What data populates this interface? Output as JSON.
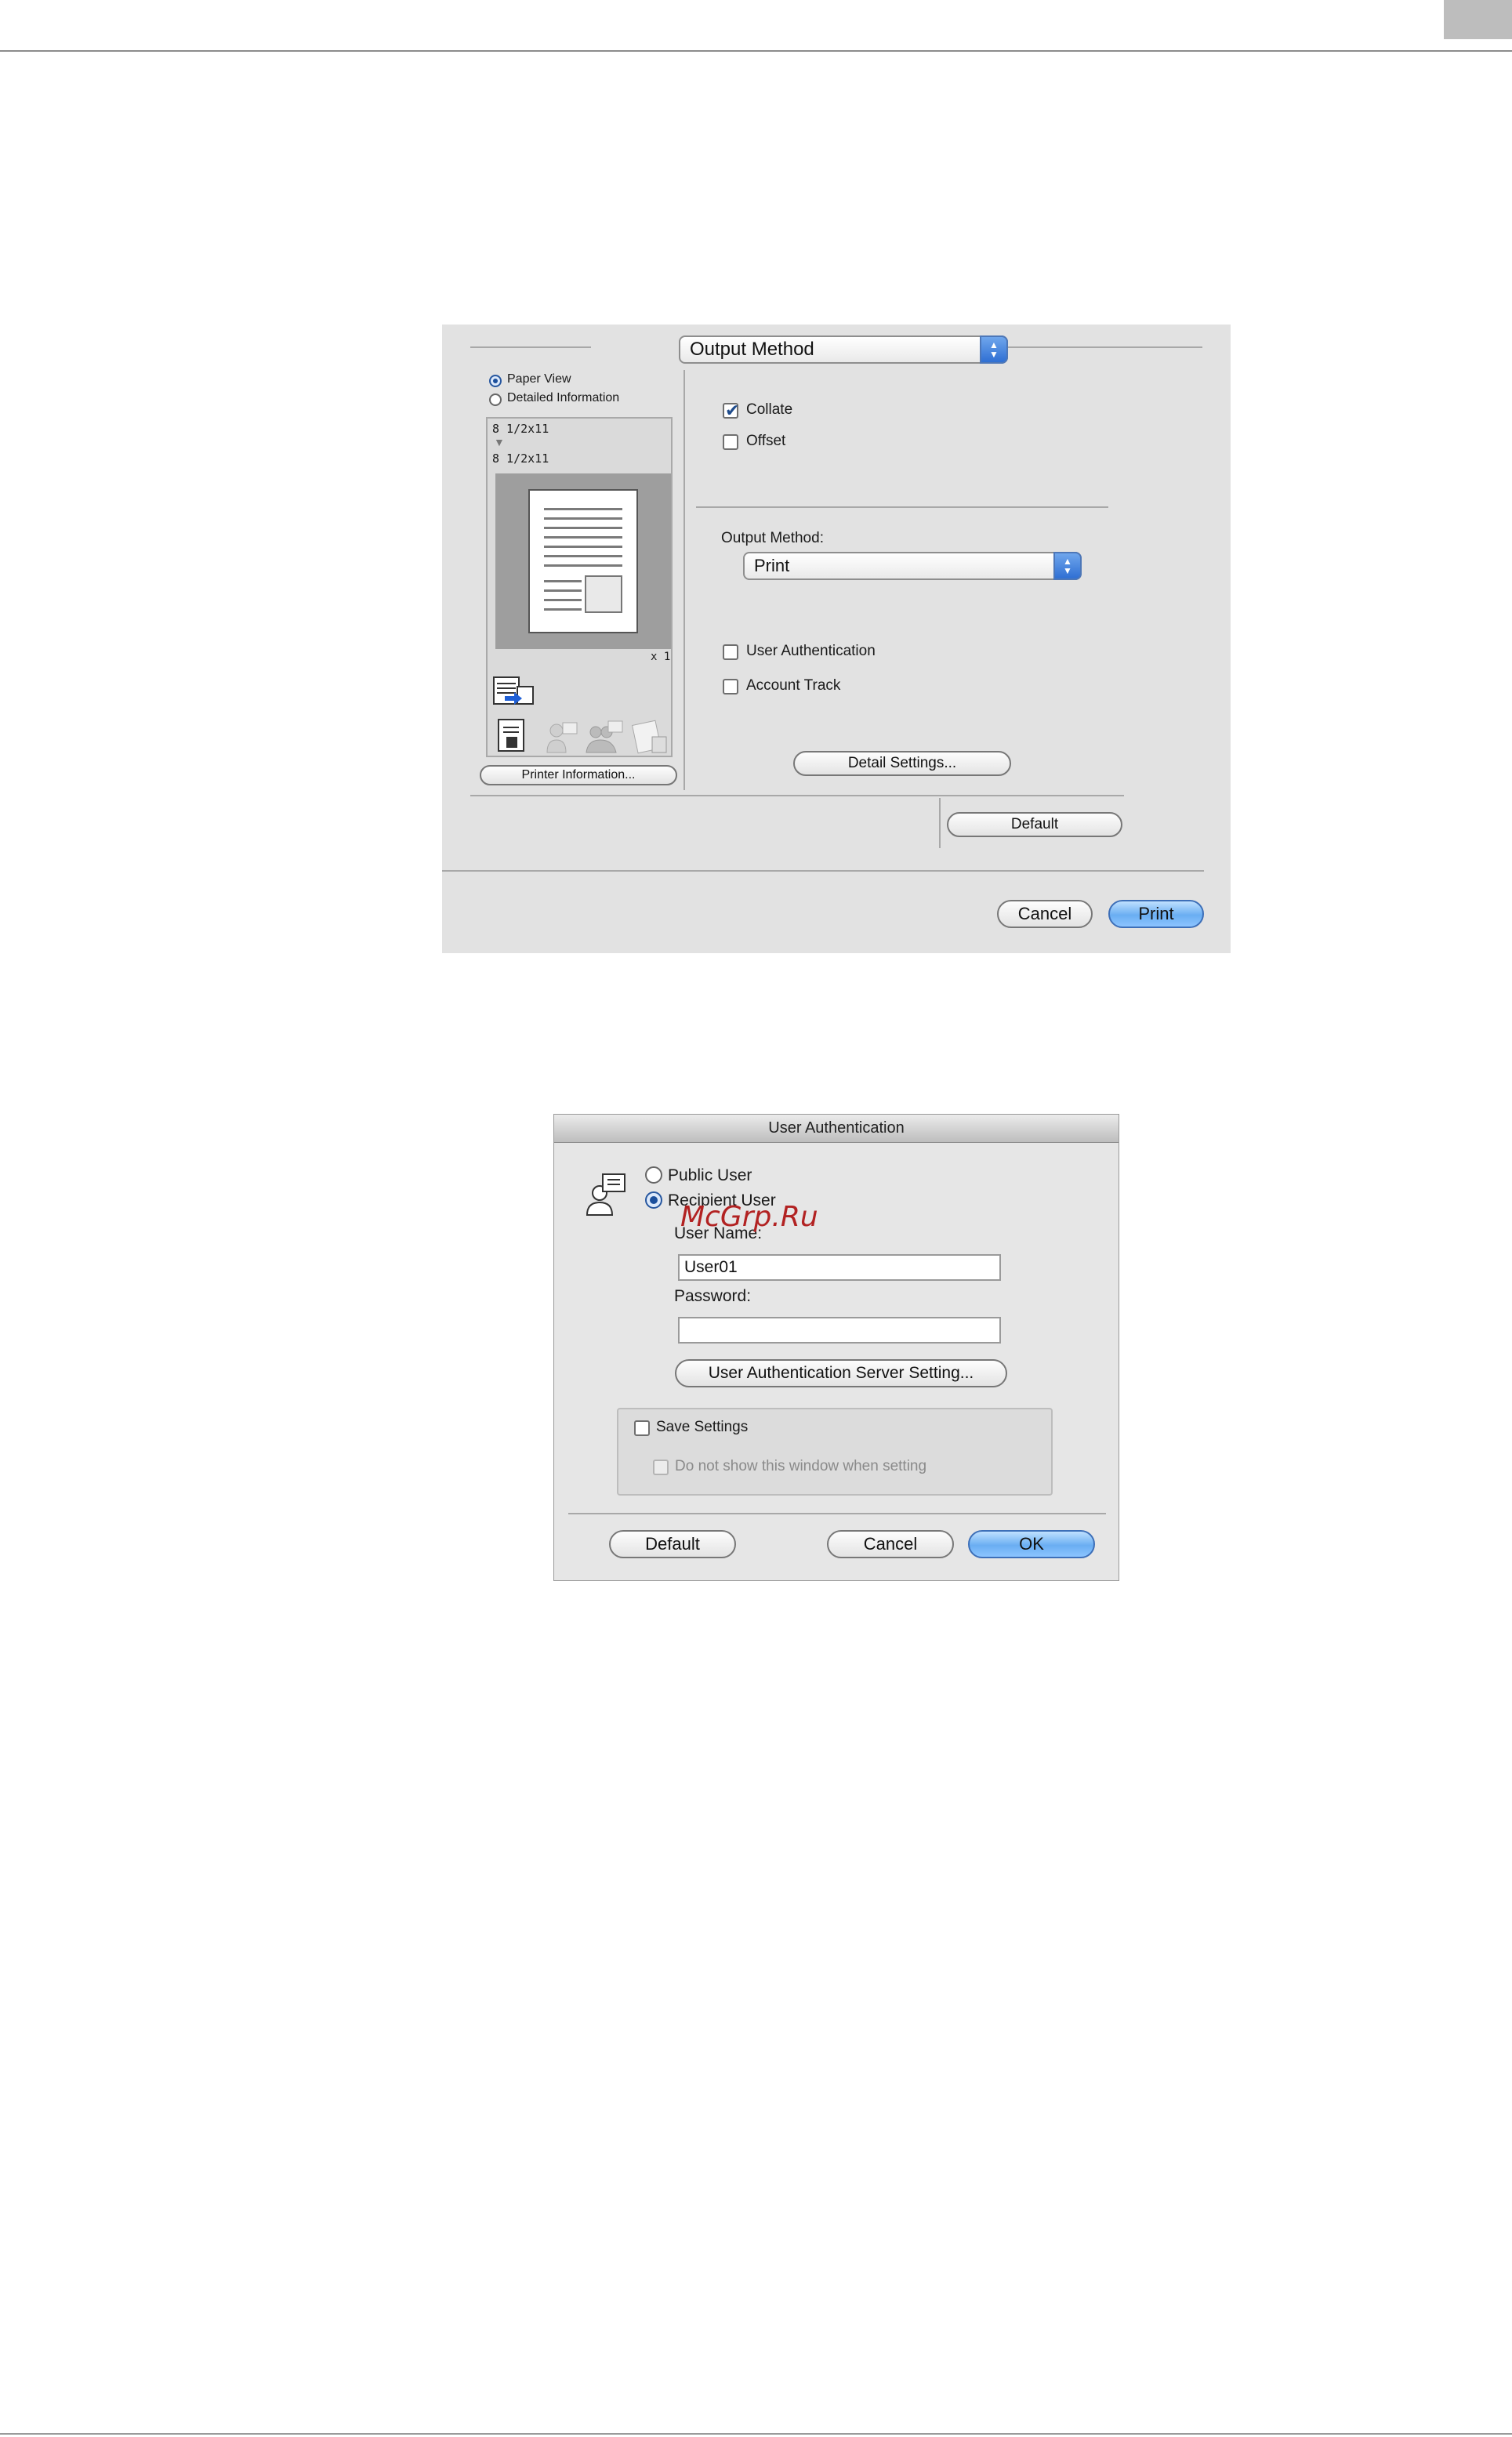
{
  "print_dialog": {
    "panel_popup": "Output Method",
    "view_options": [
      "Paper View",
      "Detailed Information"
    ],
    "selected_view": "Paper View",
    "preview": {
      "source_size": "8 1/2x11",
      "output_size": "8 1/2x11",
      "copies": "x 1"
    },
    "printer_info_button": "Printer Information...",
    "collate_label": "Collate",
    "collate_checked": true,
    "offset_label": "Offset",
    "offset_checked": false,
    "output_method_label": "Output Method:",
    "output_method_value": "Print",
    "user_auth_label": "User Authentication",
    "account_track_label": "Account Track",
    "detail_settings_button": "Detail Settings...",
    "default_button": "Default",
    "cancel_button": "Cancel",
    "print_button": "Print"
  },
  "auth_dialog": {
    "title": "User Authentication",
    "public_user_label": "Public User",
    "recipient_user_label": "Recipient User",
    "selected_user_type": "Recipient User",
    "user_name_label": "User Name:",
    "user_name_value": "User01",
    "password_label": "Password:",
    "password_value": "",
    "server_setting_button": "User Authentication Server Setting...",
    "save_settings_label": "Save Settings",
    "do_not_show_label": "Do not show this window when setting",
    "default_button": "Default",
    "cancel_button": "Cancel",
    "ok_button": "OK"
  },
  "watermark": "McGrp.Ru",
  "colors": {
    "accent_blue": "#6aaef2",
    "dialog_bg": "#e2e2e2",
    "watermark_red": "#b22222"
  }
}
